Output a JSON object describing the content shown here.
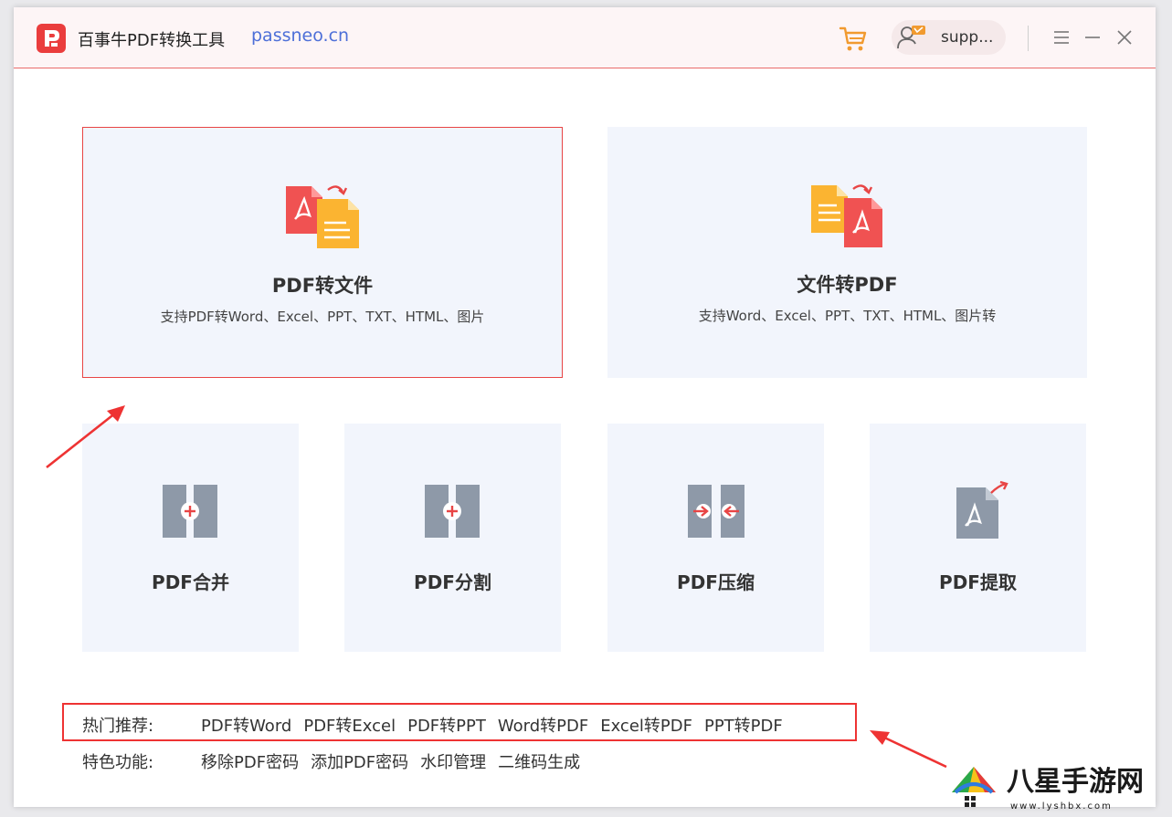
{
  "app": {
    "title": "百事牛PDF转换工具",
    "site": "passneo.cn",
    "user": "supp..."
  },
  "icons": {
    "logo": "app-logo-icon",
    "cart": "cart-icon",
    "avatar": "user-avatar-icon",
    "menu": "menu-icon",
    "minimize": "minimize-icon",
    "close": "close-icon"
  },
  "colors": {
    "accent": "#e84545",
    "card_bg": "#f2f5fc",
    "link_blue": "#4d6fd8",
    "icon_gray": "#8e99a8",
    "cart_orange": "#f19a2f"
  },
  "cards": {
    "pdf_to_file": {
      "title": "PDF转文件",
      "subtitle": "支持PDF转Word、Excel、PPT、TXT、HTML、图片"
    },
    "file_to_pdf": {
      "title": "文件转PDF",
      "subtitle": "支持Word、Excel、PPT、TXT、HTML、图片转"
    },
    "merge": {
      "title": "PDF合并"
    },
    "split": {
      "title": "PDF分割"
    },
    "compress": {
      "title": "PDF压缩"
    },
    "extract": {
      "title": "PDF提取"
    }
  },
  "hot": {
    "label": "热门推荐:",
    "links": [
      "PDF转Word",
      "PDF转Excel",
      "PDF转PPT",
      "Word转PDF",
      "Excel转PDF",
      "PPT转PDF"
    ]
  },
  "features": {
    "label": "特色功能:",
    "links": [
      "移除PDF密码",
      "添加PDF密码",
      "水印管理",
      "二维码生成"
    ]
  },
  "watermark": {
    "text": "八星手游网",
    "url": "www.lyshbx.com"
  }
}
